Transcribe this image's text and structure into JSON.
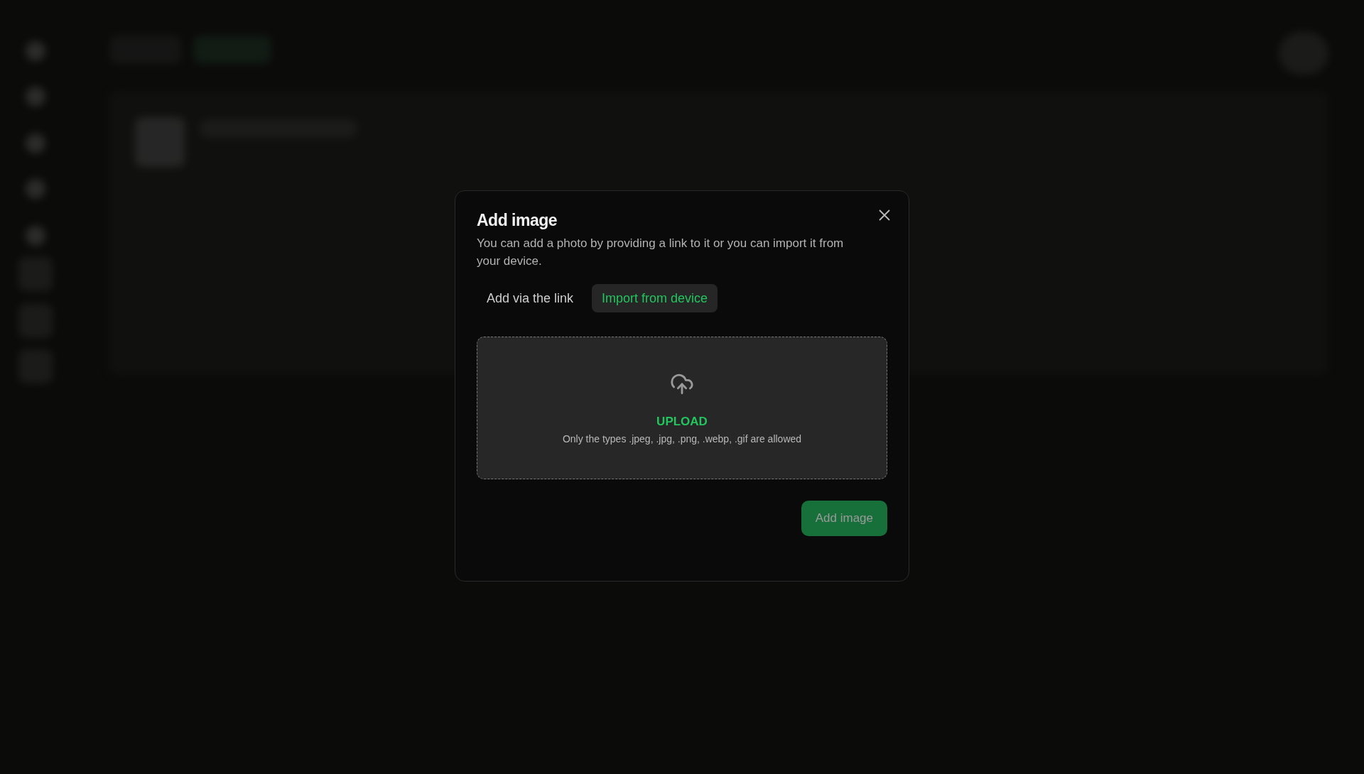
{
  "dialog": {
    "title": "Add image",
    "description": "You can add a photo by providing a link to it or you can import it from your device.",
    "tabs": [
      {
        "label": "Add via the link",
        "selected": false
      },
      {
        "label": "Import from device",
        "selected": true
      }
    ],
    "dropzone": {
      "label": "UPLOAD",
      "hint": "Only the types .jpeg, .jpg, .png, .webp, .gif are allowed"
    },
    "submit": {
      "label": "Add image",
      "disabled": true
    }
  }
}
